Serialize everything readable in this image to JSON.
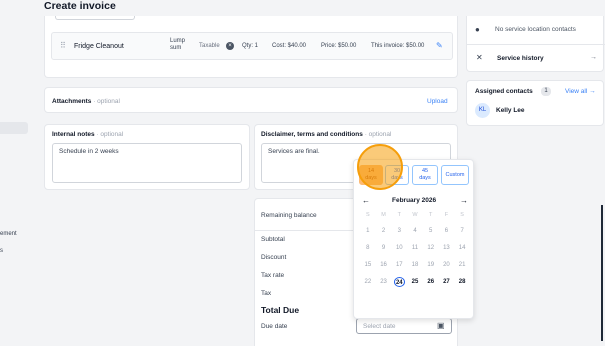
{
  "page": {
    "title": "Create invoice"
  },
  "sidebar": {
    "fragments": [
      "ement",
      "s"
    ]
  },
  "line_item": {
    "name": "Fridge Cleanout",
    "type_label": "Lump sum",
    "taxable_label": "Taxable",
    "qty": "Qty: 1",
    "cost": "Cost: $40.00",
    "price": "Price: $50.00",
    "this_invoice": "This invoice: $50.00"
  },
  "attachments": {
    "label": "Attachments",
    "optional": "· optional",
    "upload": "Upload"
  },
  "internal_notes": {
    "label": "Internal notes",
    "optional": "· optional",
    "value": "Schedule in 2 weeks"
  },
  "disclaimer": {
    "label": "Disclaimer, terms and conditions",
    "optional": "· optional",
    "value": "Services are final."
  },
  "summary": {
    "remaining_balance": "Remaining balance",
    "subtotal": "Subtotal",
    "discount": "Discount",
    "tax_rate": "Tax rate",
    "tax": "Tax",
    "total_due": "Total Due",
    "due_date": "Due date",
    "due_date_placeholder": "Select date"
  },
  "right_panel": {
    "service_location": "No service location contacts",
    "service_history": "Service history",
    "assigned_contacts": "Assigned contacts",
    "assigned_count": "1",
    "view_all": "View all →",
    "contact_initials": "KL",
    "contact_name": "Kelly Lee"
  },
  "date_picker": {
    "quick_options": [
      {
        "num": "14",
        "unit": "days"
      },
      {
        "num": "30",
        "unit": "days"
      },
      {
        "num": "45",
        "unit": "days"
      }
    ],
    "custom": "Custom",
    "month": "February 2026",
    "weekdays": [
      "S",
      "M",
      "T",
      "W",
      "T",
      "F",
      "S"
    ],
    "weeks": [
      [
        "1",
        "2",
        "3",
        "4",
        "5",
        "6",
        "7"
      ],
      [
        "8",
        "9",
        "10",
        "11",
        "12",
        "13",
        "14"
      ],
      [
        "15",
        "16",
        "17",
        "18",
        "19",
        "20",
        "21"
      ],
      [
        "22",
        "23",
        "24",
        "25",
        "26",
        "27",
        "28"
      ]
    ],
    "today": "24"
  },
  "colors": {
    "accent": "#2563eb",
    "highlight": "#f59e0b",
    "background": "#f3f4f6"
  }
}
